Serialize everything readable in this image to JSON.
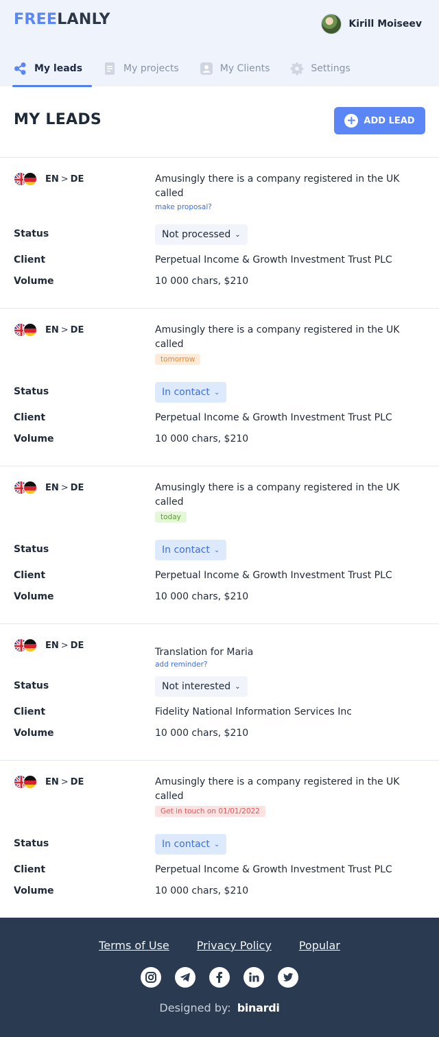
{
  "header": {
    "logo_part1": "FREE",
    "logo_part2": "LANLY",
    "user_name": "Kirill Moiseev"
  },
  "tabs": [
    {
      "label": "My leads",
      "icon": "share-nodes-icon",
      "active": true
    },
    {
      "label": "My projects",
      "icon": "document-icon",
      "active": false
    },
    {
      "label": "My Clients",
      "icon": "contact-card-icon",
      "active": false
    },
    {
      "label": "Settings",
      "icon": "gear-icon",
      "active": false
    }
  ],
  "page": {
    "title": "MY LEADS",
    "add_button": "ADD LEAD"
  },
  "labels": {
    "status": "Status",
    "client": "Client",
    "volume": "Volume"
  },
  "leads": [
    {
      "from": "EN",
      "to": "DE",
      "description": "Amusingly there is a company registered in the UK called",
      "note": "make proposal?",
      "status": "Not processed",
      "client": "Perpetual Income & Growth Investment Trust PLC",
      "volume": "10 000 chars, $210"
    },
    {
      "from": "EN",
      "to": "DE",
      "description": "Amusingly there is a company registered in the UK called",
      "badge": "tomorrow",
      "status": "In contact",
      "client": "Perpetual Income & Growth Investment Trust PLC",
      "volume": "10 000 chars, $210"
    },
    {
      "from": "EN",
      "to": "DE",
      "description": "Amusingly there is a company registered in the UK called",
      "badge": "today",
      "status": "In contact",
      "client": "Perpetual Income & Growth Investment Trust PLC",
      "volume": "10 000 chars, $210"
    },
    {
      "from": "EN",
      "to": "DE",
      "description": "Translation for Maria",
      "note": "add reminder?",
      "status": "Not interested",
      "client": "Fidelity National Information Services Inc",
      "volume": "10 000 chars, $210"
    },
    {
      "from": "EN",
      "to": "DE",
      "description": "Amusingly there is a company registered in the UK called",
      "badge": "Get in touch on 01/01/2022",
      "status": "In contact",
      "client": "Perpetual Income & Growth Investment Trust PLC",
      "volume": "10 000 chars, $210"
    }
  ],
  "footer": {
    "links": [
      "Terms of Use",
      "Privacy Policy",
      "Popular"
    ],
    "socials": [
      "instagram-icon",
      "telegram-icon",
      "facebook-icon",
      "linkedin-icon",
      "twitter-icon"
    ],
    "designed_by": "Designed by:",
    "brand": "binardi"
  },
  "colors": {
    "accent": "#5b86f5",
    "header_bg": "#eef3fc",
    "footer_bg": "#2a3a50",
    "status_contact_bg": "#dde9fd",
    "badge_tomorrow_bg": "#fdebd8",
    "badge_today_bg": "#e4f7d6",
    "badge_due_bg": "#fde2e2"
  }
}
